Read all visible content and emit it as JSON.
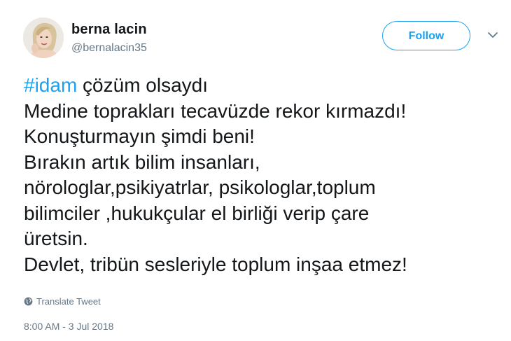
{
  "author": {
    "display_name": "berna lacin",
    "handle": "@bernalacin35"
  },
  "follow_button": {
    "label": "Follow"
  },
  "tweet": {
    "hashtag": "#idam",
    "line1_rest": " çözüm olsaydı",
    "lines": [
      "Medine toprakları tecavüzde rekor kırmazdı!",
      "Konuşturmayın şimdi beni!",
      "Bırakın artık bilim insanları,",
      "nörologlar,psikiyatrlar, psikologlar,toplum",
      "bilimciler ,hukukçular el birliği verip çare",
      "üretsin.",
      "Devlet, tribün sesleriyle toplum inşaa etmez!"
    ]
  },
  "translate": {
    "label": "Translate Tweet",
    "icon": "globe-icon"
  },
  "timestamp": "8:00 AM - 3 Jul 2018",
  "colors": {
    "accent": "#1da1f2",
    "text": "#14171a",
    "secondary": "#657786"
  }
}
